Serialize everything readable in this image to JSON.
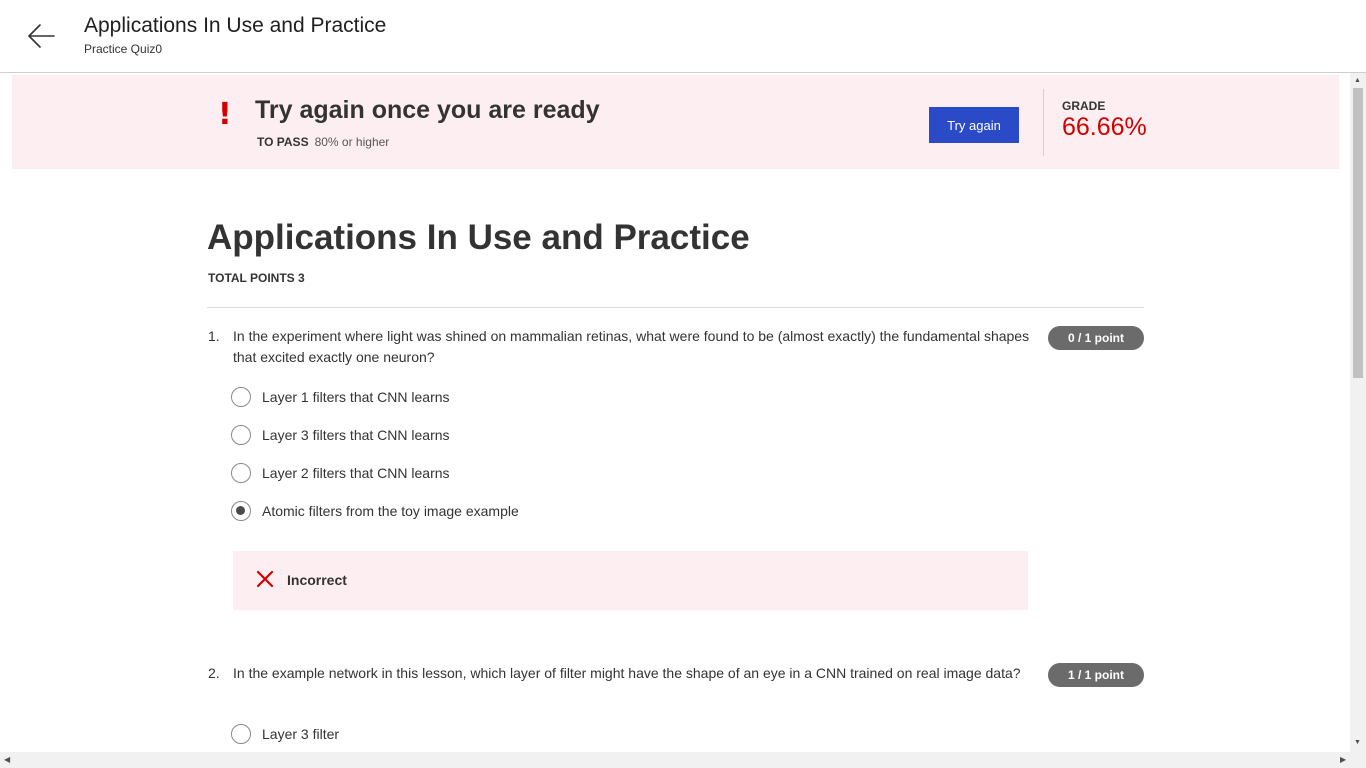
{
  "header": {
    "title": "Applications In Use and Practice",
    "subtitle": "Practice Quiz0",
    "back_icon": "arrow-left-icon"
  },
  "banner": {
    "alert_symbol": "!",
    "heading": "Try again once you are ready",
    "pass_label": "TO PASS",
    "pass_value": "80% or higher",
    "try_again_label": "Try again",
    "grade_label": "GRADE",
    "grade_value": "66.66%",
    "accent_color": "#d30000",
    "button_color": "#2a4ac7"
  },
  "quiz": {
    "title": "Applications In Use and Practice",
    "total_points": "TOTAL POINTS 3",
    "questions": [
      {
        "number": "1.",
        "text": "In the experiment where light was shined on mammalian retinas, what were found to be (almost exactly) the fundamental shapes that excited exactly one neuron?",
        "score": "0 / 1 point",
        "options": [
          {
            "label": "Layer 1 filters that CNN learns",
            "selected": false
          },
          {
            "label": "Layer 3 filters that CNN learns",
            "selected": false
          },
          {
            "label": "Layer 2 filters that CNN learns",
            "selected": false
          },
          {
            "label": "Atomic filters from the toy image example",
            "selected": true
          }
        ],
        "feedback": {
          "icon": "close-x-icon",
          "text": "Incorrect"
        }
      },
      {
        "number": "2.",
        "text": "In the example network in this lesson, which layer of filter might have the shape of an eye in a CNN trained on real image data?",
        "score": "1 / 1 point",
        "options": [
          {
            "label": "Layer 3 filter",
            "selected": false
          }
        ]
      }
    ]
  },
  "scrollbars": {
    "up_arrow": "▲",
    "down_arrow": "▼",
    "left_arrow": "◀",
    "right_arrow": "▶"
  }
}
